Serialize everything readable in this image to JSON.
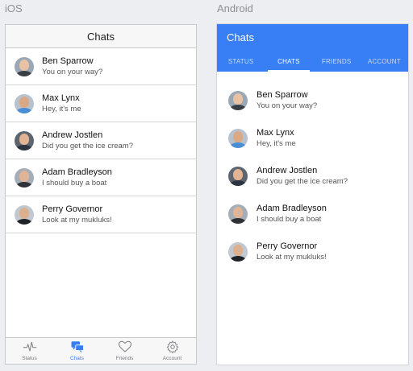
{
  "labels": {
    "ios": "iOS",
    "android": "Android"
  },
  "ios": {
    "nav_title": "Chats",
    "chats": [
      {
        "name": "Ben Sparrow",
        "message": "You on your way?"
      },
      {
        "name": "Max Lynx",
        "message": "Hey, it's me"
      },
      {
        "name": "Andrew Jostlen",
        "message": "Did you get the ice cream?"
      },
      {
        "name": "Adam Bradleyson",
        "message": "I should buy a boat"
      },
      {
        "name": "Perry Governor",
        "message": "Look at my mukluks!"
      }
    ],
    "tabs": [
      {
        "label": "Status",
        "icon": "pulse-icon"
      },
      {
        "label": "Chats",
        "icon": "chat-bubbles-icon",
        "active": true
      },
      {
        "label": "Friends",
        "icon": "heart-icon"
      },
      {
        "label": "Account",
        "icon": "gear-icon"
      }
    ],
    "accent_color": "#387ef5"
  },
  "android": {
    "title": "Chats",
    "tabs": [
      {
        "label": "STATUS"
      },
      {
        "label": "CHATS",
        "active": true
      },
      {
        "label": "FRIENDS"
      },
      {
        "label": "ACCOUNT"
      }
    ],
    "chats": [
      {
        "name": "Ben Sparrow",
        "message": "You on your way?"
      },
      {
        "name": "Max Lynx",
        "message": "Hey, it's me"
      },
      {
        "name": "Andrew Jostlen",
        "message": "Did you get the ice cream?"
      },
      {
        "name": "Adam Bradleyson",
        "message": "I should buy a boat"
      },
      {
        "name": "Perry Governor",
        "message": "Look at my mukluks!"
      }
    ],
    "header_color": "#387ef5"
  }
}
